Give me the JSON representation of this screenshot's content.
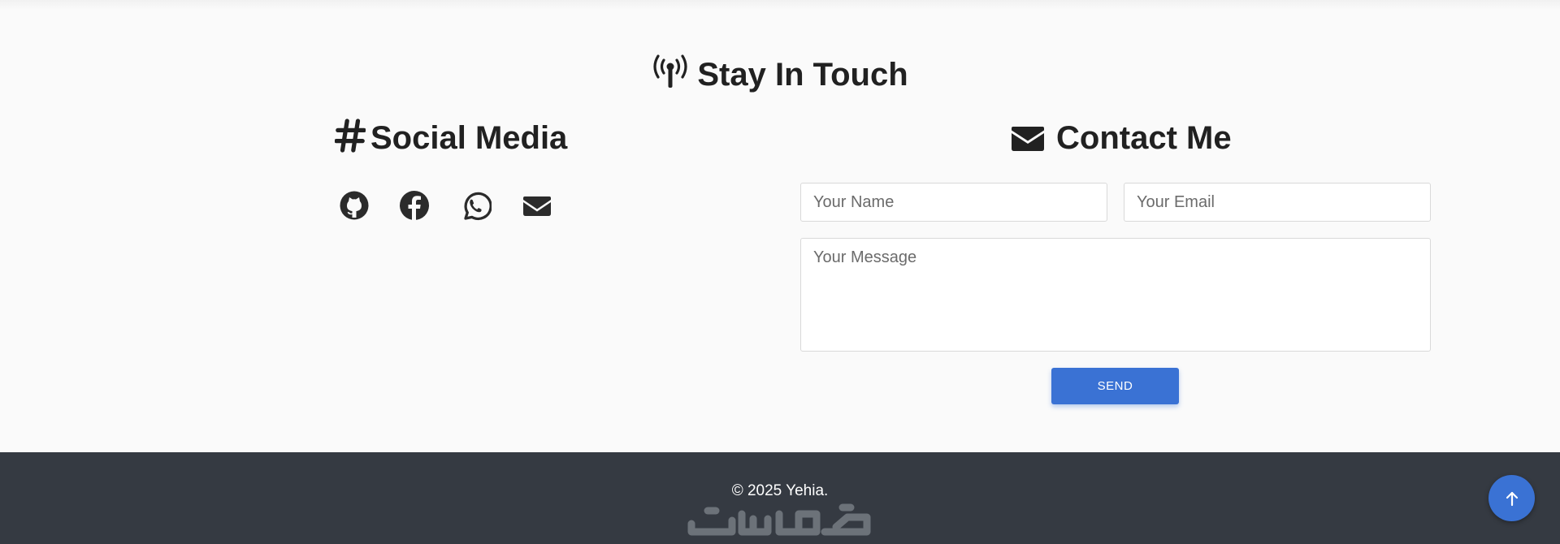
{
  "section": {
    "title": "Stay In Touch",
    "icon": "broadcast-tower-icon"
  },
  "social": {
    "title": "Social Media",
    "icon": "hashtag-icon",
    "links": [
      {
        "name": "github-icon"
      },
      {
        "name": "facebook-icon"
      },
      {
        "name": "whatsapp-icon"
      },
      {
        "name": "envelope-icon"
      }
    ]
  },
  "contact": {
    "title": "Contact Me",
    "icon": "envelope-icon",
    "name_placeholder": "Your Name",
    "email_placeholder": "Your Email",
    "message_placeholder": "Your Message",
    "send_label": "SEND"
  },
  "footer": {
    "copyright": "© 2025 Yehia.",
    "watermark": "خمسات"
  },
  "colors": {
    "accent": "#3a72d4",
    "footer_bg": "#353a42",
    "section_bg": "#fafafa",
    "text": "#212121"
  },
  "back_to_top": {
    "icon": "arrow-up-icon"
  }
}
